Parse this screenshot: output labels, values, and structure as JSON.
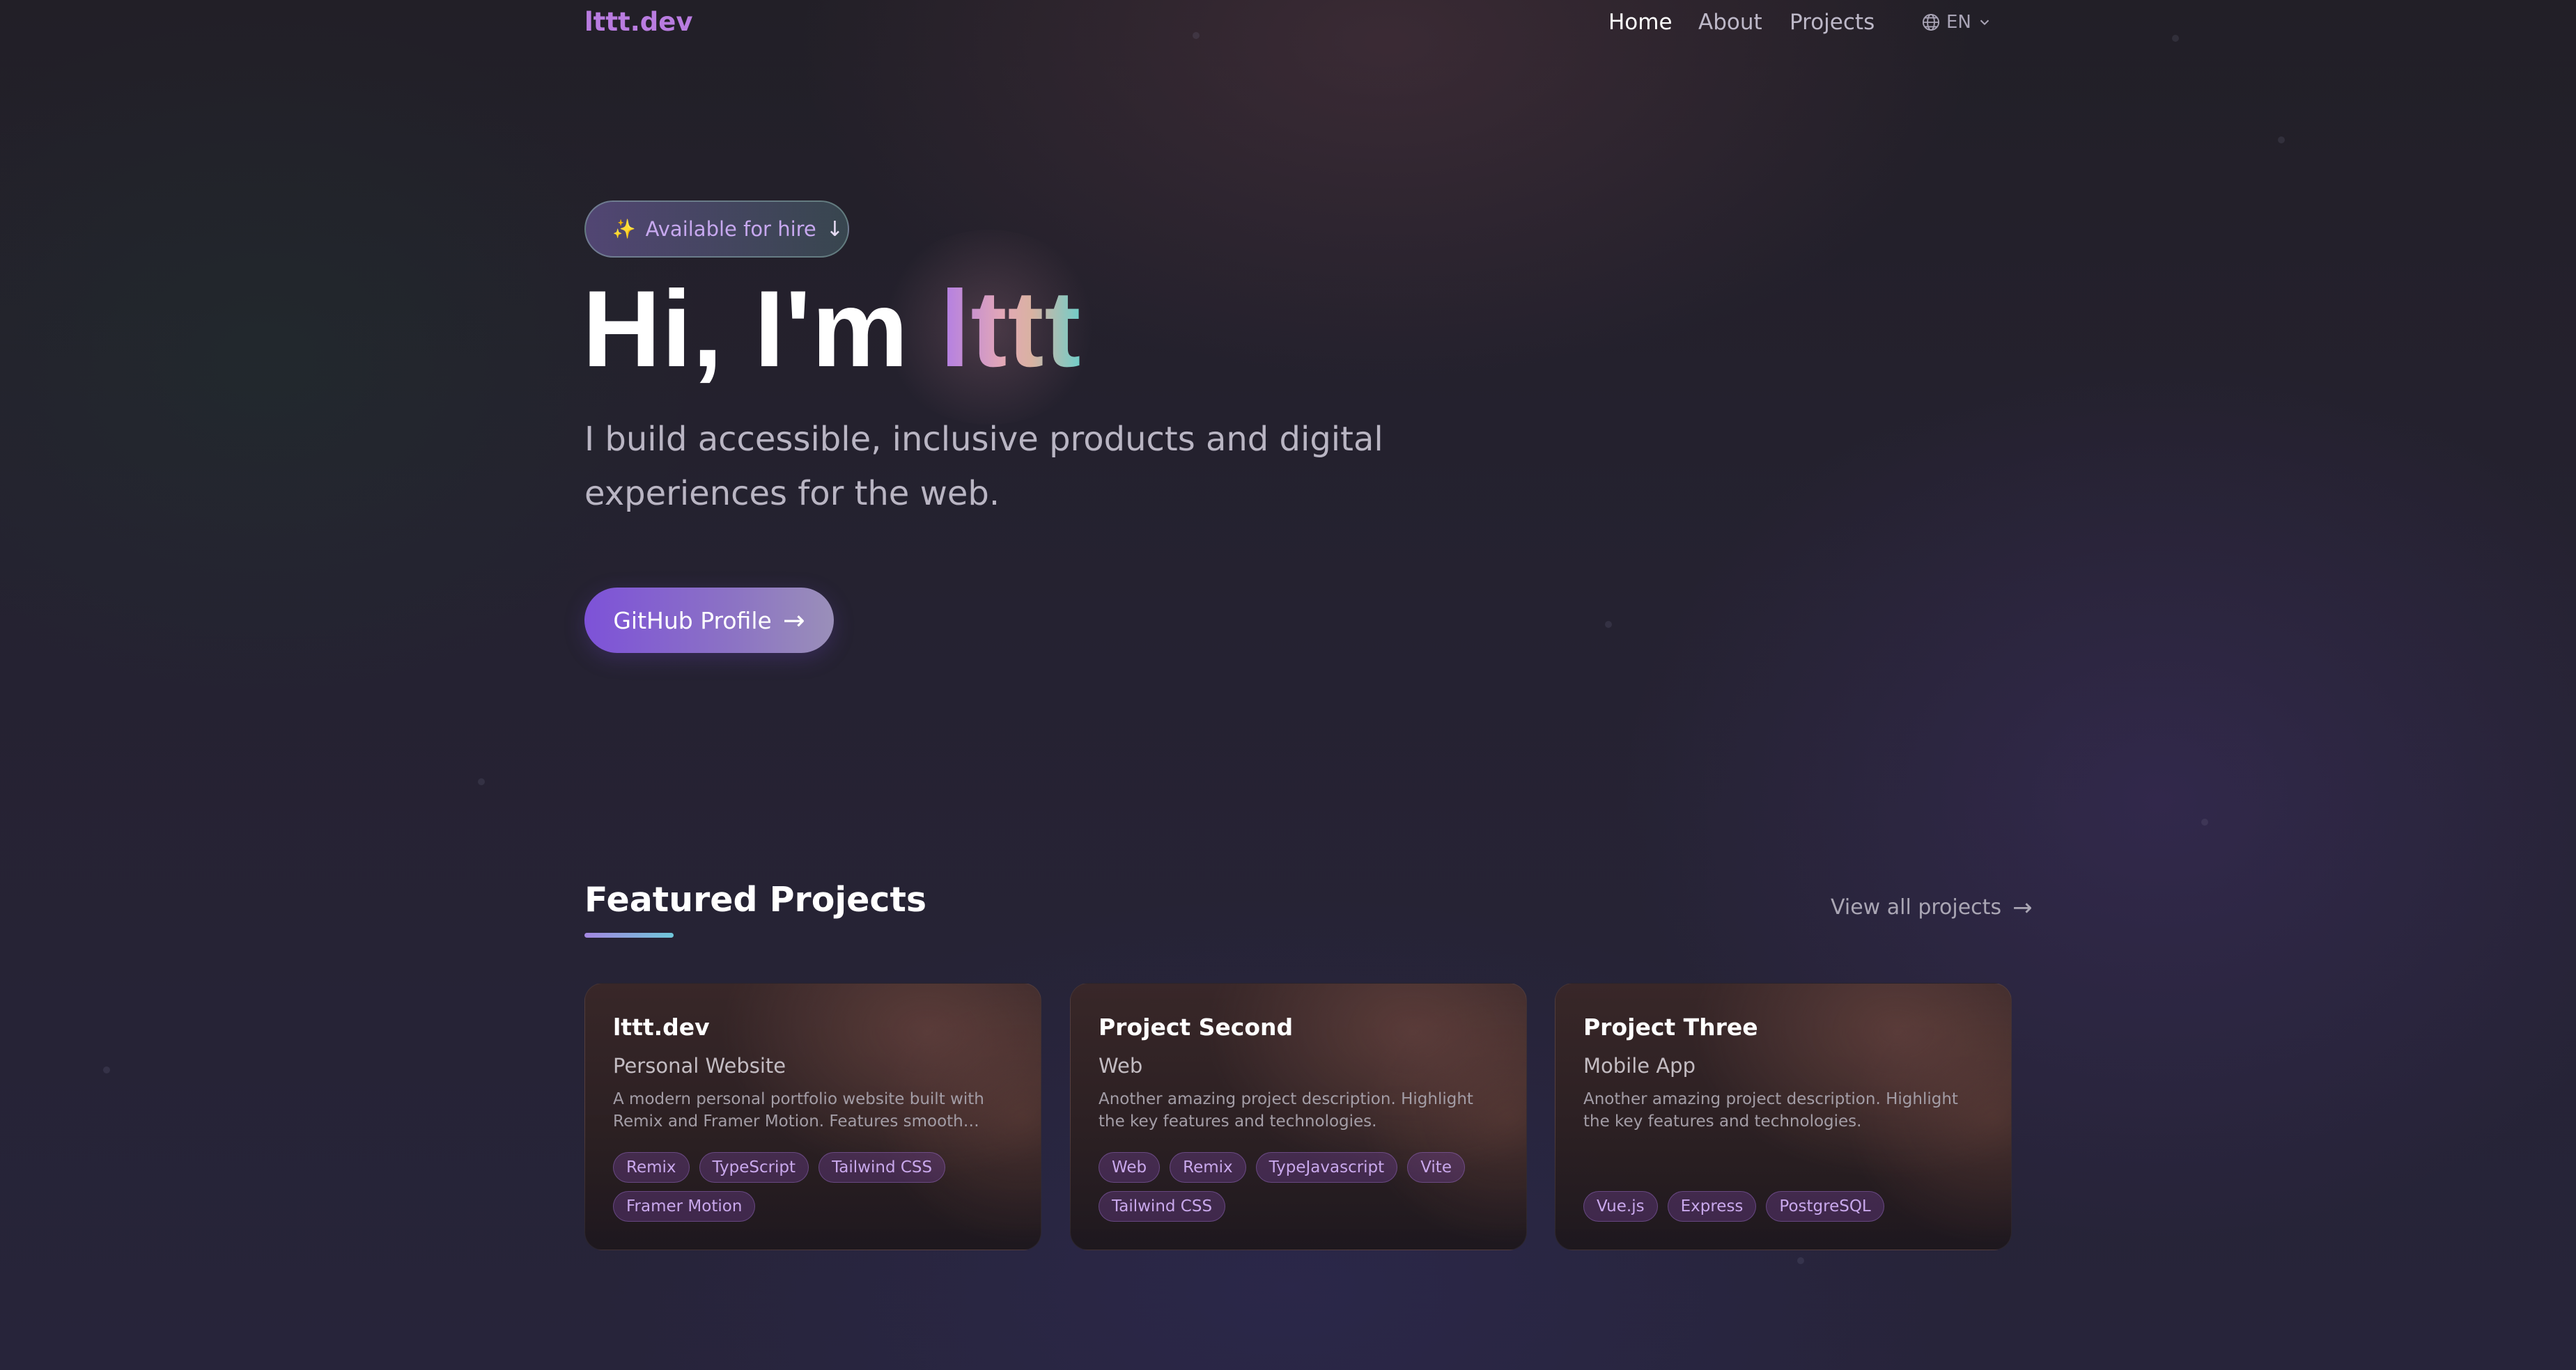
{
  "nav": {
    "brand": "lttt.dev",
    "links": [
      {
        "label": "Home",
        "active": true
      },
      {
        "label": "About",
        "active": false
      },
      {
        "label": "Projects",
        "active": false
      }
    ],
    "language": "EN"
  },
  "hero": {
    "badge": "Available for hire",
    "badge_arrow": "↓",
    "title_prefix": "Hi, I'm ",
    "title_name": "lttt",
    "subtitle": "I build accessible, inclusive products and digital experiences for the web.",
    "cta_label": "GitHub Profile",
    "cta_arrow": "→"
  },
  "featured": {
    "title": "Featured Projects",
    "view_all": "View all projects",
    "view_all_arrow": "→",
    "projects": [
      {
        "title": "lttt.dev",
        "category": "Personal Website",
        "description": "A modern personal portfolio website built with Remix and Framer Motion. Features smooth…",
        "tags": [
          "Remix",
          "TypeScript",
          "Tailwind CSS",
          "Framer Motion"
        ]
      },
      {
        "title": "Project Second",
        "category": "Web",
        "description": "Another amazing project description. Highlight the key features and technologies.",
        "tags": [
          "Web",
          "Remix",
          "TypeJavascript",
          "Vite",
          "Tailwind CSS"
        ]
      },
      {
        "title": "Project Three",
        "category": "Mobile App",
        "description": "Another amazing project description. Highlight the key features and technologies.",
        "tags": [
          "Vue.js",
          "Express",
          "PostgreSQL"
        ]
      }
    ]
  },
  "colors": {
    "brand": "#b97ce0",
    "accent_purple": "#7d52d8",
    "accent_teal": "#6fcec9",
    "tag_text": "#c9a8ec"
  },
  "icons": {
    "language": "globe-icon",
    "language_toggle": "chevron-down-icon",
    "badge": "sparkles-icon"
  }
}
